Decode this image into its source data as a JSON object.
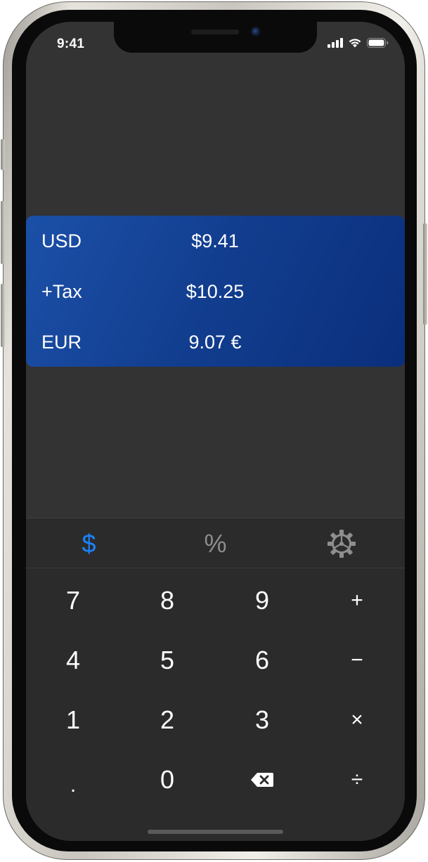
{
  "status_bar": {
    "time": "9:41",
    "icons": [
      "cellular-signal-icon",
      "wifi-icon",
      "battery-icon"
    ]
  },
  "results": {
    "rows": [
      {
        "label": "USD",
        "value": "$9.41"
      },
      {
        "label": "+Tax",
        "value": "$10.25"
      },
      {
        "label": "EUR",
        "value": "9.07 €"
      }
    ],
    "card_color_start": "#1b50a8",
    "card_color_end": "#0a2f7c"
  },
  "mode_bar": {
    "currency_symbol": "$",
    "percent_symbol": "%",
    "settings_icon": "gear-icon",
    "active_color": "#1a84ff",
    "inactive_color": "#8e8e8e"
  },
  "keypad": {
    "rows": [
      [
        "7",
        "8",
        "9",
        "+"
      ],
      [
        "4",
        "5",
        "6",
        "−"
      ],
      [
        "1",
        "2",
        "3",
        "×"
      ],
      [
        ".",
        "0",
        "backspace-icon",
        "÷"
      ]
    ]
  },
  "colors": {
    "screen_background": "#333333",
    "keypad_background": "#2b2b2b",
    "text": "#ffffff"
  }
}
